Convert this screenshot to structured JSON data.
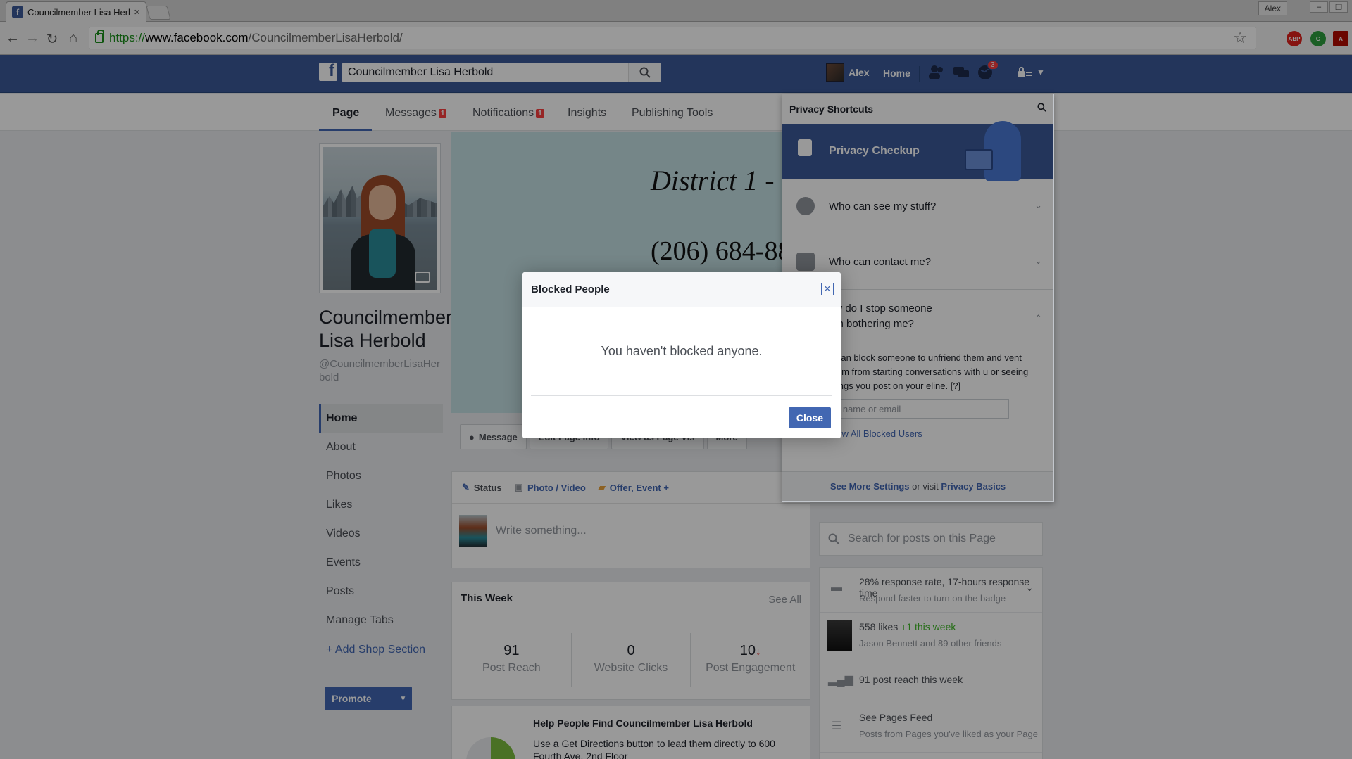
{
  "browser": {
    "tab_title": "Councilmember Lisa Herb",
    "tab_close": "×",
    "window_user": "Alex",
    "url_proto": "https://",
    "url_host": "www.facebook.com",
    "url_path": "/CouncilmemberLisaHerbold/"
  },
  "fb_header": {
    "search_value": "Councilmember Lisa Herbold",
    "user_name": "Alex",
    "home_label": "Home",
    "notifications_count": "3"
  },
  "page_tabs": [
    {
      "label": "Page",
      "badge": ""
    },
    {
      "label": "Messages",
      "badge": "1"
    },
    {
      "label": "Notifications",
      "badge": "1"
    },
    {
      "label": "Insights",
      "badge": ""
    },
    {
      "label": "Publishing Tools",
      "badge": ""
    }
  ],
  "profile": {
    "name": "Councilmember Lisa Herbold",
    "handle": "@CouncilmemberLisaHerbold"
  },
  "left_nav": [
    "Home",
    "About",
    "Photos",
    "Likes",
    "Videos",
    "Events",
    "Posts",
    "Manage Tabs"
  ],
  "add_shop": "+ Add Shop Section",
  "promote": "Promote",
  "cover": {
    "title": "District 1 - W",
    "phone": "(206) 684-880"
  },
  "actions": [
    "Message",
    "Edit Page Info",
    "View as Page Vis",
    "More"
  ],
  "composer": {
    "tabs": [
      "Status",
      "Photo / Video",
      "Offer, Event +"
    ],
    "placeholder": "Write something..."
  },
  "this_week": {
    "title": "This Week",
    "see_all": "See All",
    "stats": [
      {
        "value": "91",
        "label": "Post Reach",
        "trend": ""
      },
      {
        "value": "0",
        "label": "Website Clicks",
        "trend": ""
      },
      {
        "value": "10",
        "label": "Post Engagement",
        "trend": "down"
      }
    ]
  },
  "help": {
    "title": "Help People Find Councilmember Lisa Herbold",
    "body": "Use a Get Directions button to lead them directly to 600 Fourth Ave. 2nd Floor"
  },
  "right": {
    "search_placeholder": "Search for posts on this Page",
    "response_main": "28% response rate, 17-hours response time",
    "response_sub": "Respond faster to turn on the badge",
    "likes_main": "558 likes",
    "likes_green": "+1 this week",
    "likes_sub": "Jason Bennett and 89 other friends",
    "reach": "91 post reach this week",
    "feed_main": "See Pages Feed",
    "feed_sub": "Posts from Pages you've liked as your Page"
  },
  "privacy": {
    "header": "Privacy Shortcuts",
    "checkup": "Privacy Checkup",
    "row1": "Who can see my stuff?",
    "row2": "Who can contact me?",
    "row3_line1": "ow do I stop someone",
    "row3_line2": "om bothering me?",
    "open_body": "u can block someone to unfriend them and vent them from starting conversations with u or seeing things you post on your eline. [?]",
    "input_placeholder": "d name or email",
    "view_all": "View All Blocked Users",
    "footer_see_more": "See More Settings",
    "footer_or": " or visit ",
    "footer_basics": "Privacy Basics"
  },
  "modal": {
    "title": "Blocked People",
    "message": "You haven't blocked anyone.",
    "close_label": "Close"
  },
  "colors": {
    "fb_blue": "#3b5998",
    "link_blue": "#4267b2",
    "badge_red": "#fa3e3e",
    "overlay": "rgba(0,0,0,0.4)"
  }
}
